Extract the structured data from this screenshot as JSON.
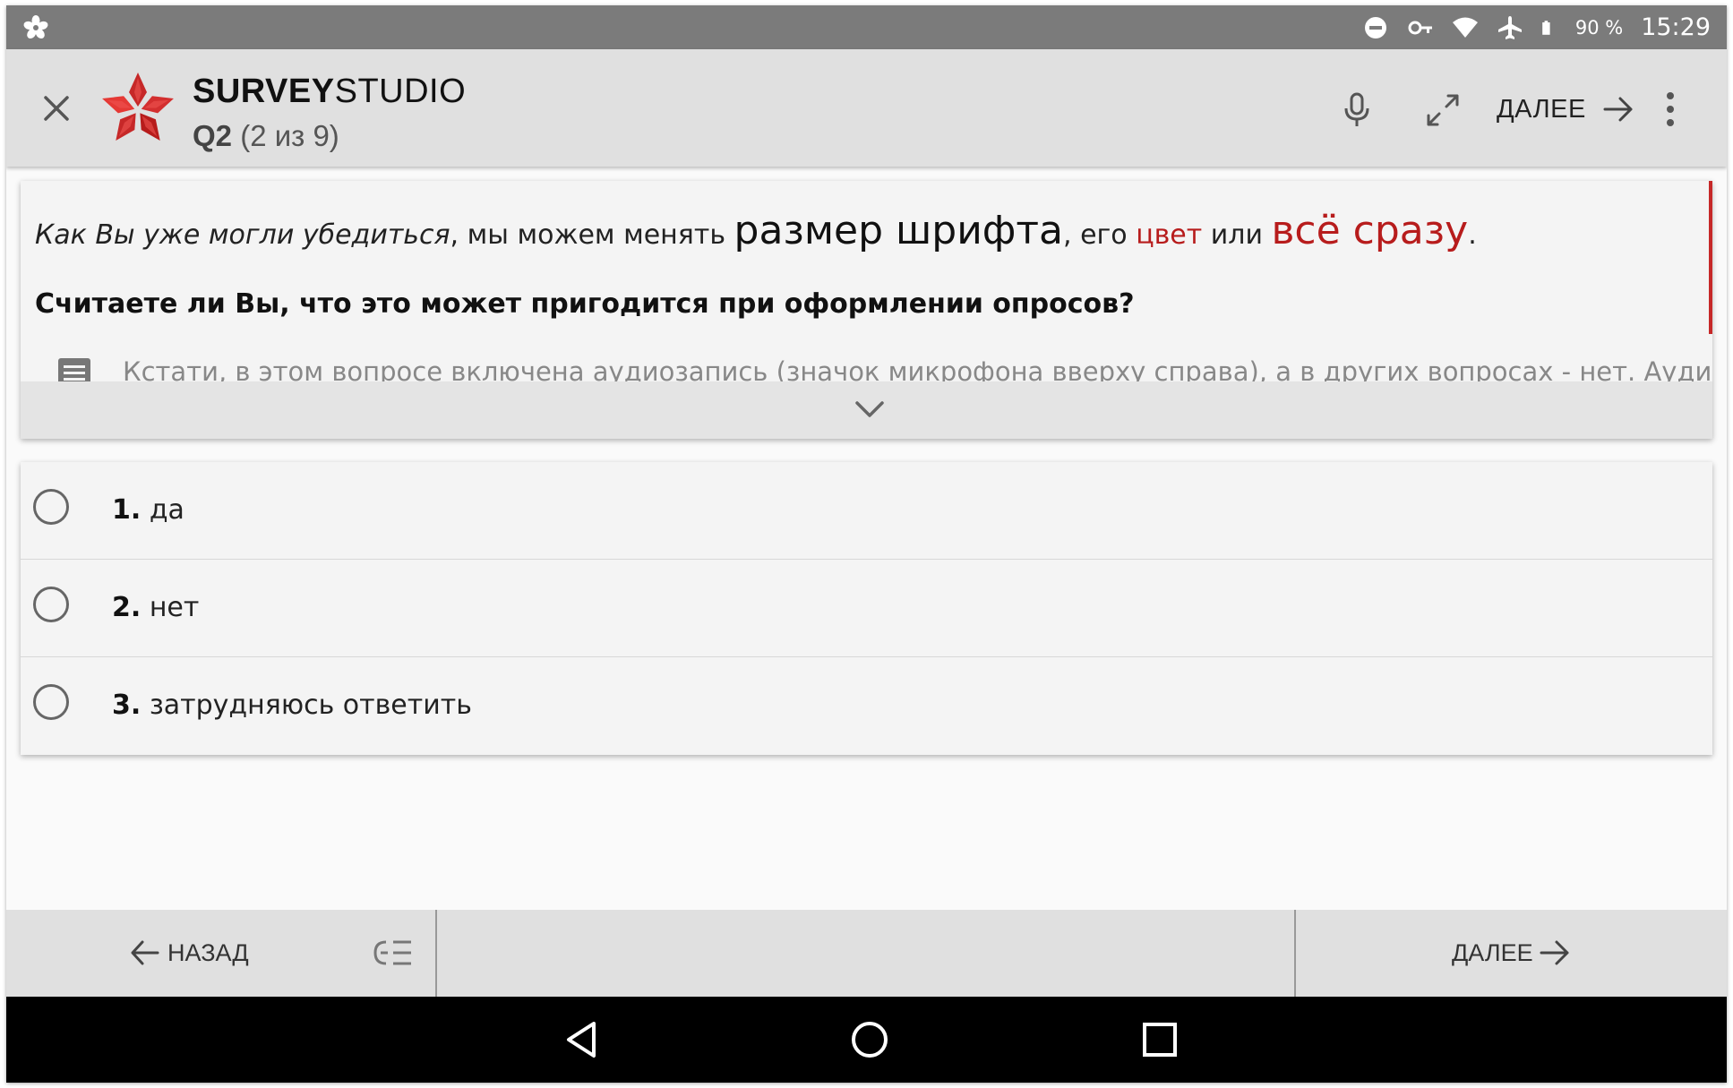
{
  "status_bar": {
    "battery": "90 %",
    "time": "15:29",
    "icons": [
      "app-flower-icon",
      "do-not-disturb-icon",
      "vpn-key-icon",
      "wifi-icon",
      "airplane-icon",
      "battery-icon"
    ]
  },
  "app_bar": {
    "brand_bold": "SURVEY",
    "brand_light": "STUDIO",
    "question_id": "Q2",
    "question_progress": "(2 из 9)",
    "next_label": "ДАЛЕЕ",
    "icons": [
      "close-icon",
      "logo-flower",
      "microphone-icon",
      "fullscreen-icon",
      "arrow-right-icon",
      "more-vert-icon"
    ]
  },
  "question": {
    "intro_italic": "Как Вы уже могли убедиться",
    "intro_plain": ", мы можем менять ",
    "intro_big": "размер шрифта",
    "intro_mid": ", его ",
    "intro_color": "цвет",
    "intro_or": " или ",
    "intro_all": "всё сразу",
    "intro_end": ".",
    "prompt": "Считаете ли Вы, что это может пригодится при оформлении опросов?",
    "note": "Кстати, в этом вопросе включена аудиозапись (значок микрофона вверху справа), а в других вопросах - нет. Аудиозапись",
    "accent_color": "#b71c1c"
  },
  "answers": [
    {
      "num": "1.",
      "text": " да"
    },
    {
      "num": "2.",
      "text": " нет"
    },
    {
      "num": "3.",
      "text": " затрудняюсь ответить"
    }
  ],
  "bottom_bar": {
    "back_label": "НАЗАД",
    "next_label": "ДАЛЕЕ"
  },
  "nav_bar": {
    "icons": [
      "nav-back-icon",
      "nav-home-icon",
      "nav-recents-icon"
    ]
  }
}
